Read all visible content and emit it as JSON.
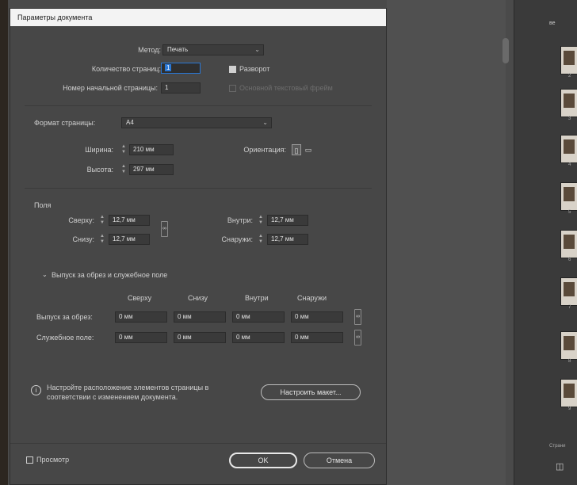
{
  "dialog": {
    "title": "Параметры документа",
    "intent": {
      "label": "Метод:",
      "value": "Печать"
    },
    "pages": {
      "label": "Количество страниц:",
      "value": "1",
      "facing_label": "Разворот"
    },
    "start_page": {
      "label": "Номер начальной страницы:",
      "value": "1",
      "primary_frame_label": "Основной текстовый фрейм"
    },
    "page_size": {
      "label": "Формат страницы:",
      "value": "A4"
    },
    "width": {
      "label": "Ширина:",
      "value": "210 мм"
    },
    "height": {
      "label": "Высота:",
      "value": "297 мм"
    },
    "orientation": {
      "label": "Ориентация:"
    },
    "margins": {
      "title": "Поля",
      "top": {
        "label": "Сверху:",
        "value": "12,7 мм"
      },
      "bottom": {
        "label": "Снизу:",
        "value": "12,7 мм"
      },
      "inside": {
        "label": "Внутри:",
        "value": "12,7 мм"
      },
      "outside": {
        "label": "Снаружи:",
        "value": "12,7 мм"
      }
    },
    "bleed_slug": {
      "title": "Выпуск за обрез и служебное поле",
      "col_top": "Сверху",
      "col_bottom": "Снизу",
      "col_inside": "Внутри",
      "col_outside": "Снаружи",
      "bleed_label": "Выпуск за обрез:",
      "slug_label": "Служебное поле:",
      "bleed_values": [
        "0 мм",
        "0 мм",
        "0 мм",
        "0 мм"
      ],
      "slug_values": [
        "0 мм",
        "0 мм",
        "0 мм",
        "0 мм"
      ]
    },
    "info": {
      "text": "Настройте расположение элементов страницы в соответствии с изменением документа.",
      "button": "Настроить макет..."
    },
    "preview_label": "Просмотр",
    "ok_label": "OK",
    "cancel_label": "Отмена"
  },
  "panel": {
    "header": "ве",
    "footer": "Страни",
    "page_numbers": [
      "2",
      "3",
      "4",
      "5",
      "6",
      "7",
      "8",
      "9"
    ]
  }
}
